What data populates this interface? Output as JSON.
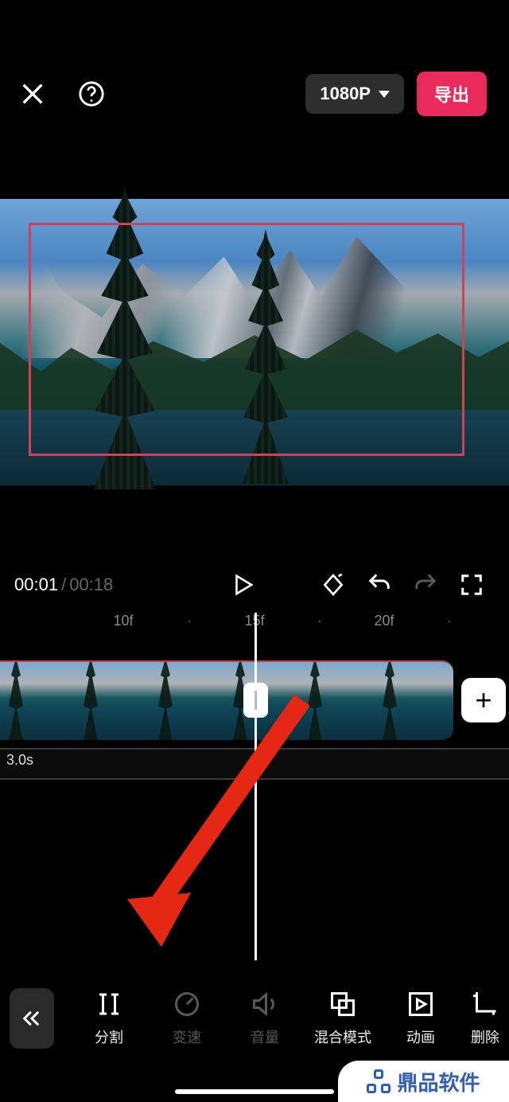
{
  "header": {
    "resolution_label": "1080P",
    "export_label": "导出"
  },
  "playback": {
    "current_time": "00:01",
    "total_time": "00:18"
  },
  "ruler": {
    "marks": [
      "10f",
      "15f",
      "20f"
    ]
  },
  "subclip": {
    "duration_label": "3.0s"
  },
  "toolbar": {
    "items": [
      {
        "id": "split",
        "label": "分割",
        "enabled": true
      },
      {
        "id": "speed",
        "label": "变速",
        "enabled": false
      },
      {
        "id": "volume",
        "label": "音量",
        "enabled": false
      },
      {
        "id": "blend",
        "label": "混合模式",
        "enabled": true
      },
      {
        "id": "anim",
        "label": "动画",
        "enabled": true
      },
      {
        "id": "delete",
        "label": "删除",
        "enabled": true
      }
    ]
  },
  "watermark": {
    "text": "鼎品软件"
  },
  "icons": {
    "close": "close-icon",
    "help": "help-icon",
    "play": "play-icon",
    "keyframe": "keyframe-icon",
    "undo": "undo-icon",
    "redo": "redo-icon",
    "fullscreen": "fullscreen-icon",
    "add": "plus-icon",
    "back": "chevrons-left-icon"
  }
}
